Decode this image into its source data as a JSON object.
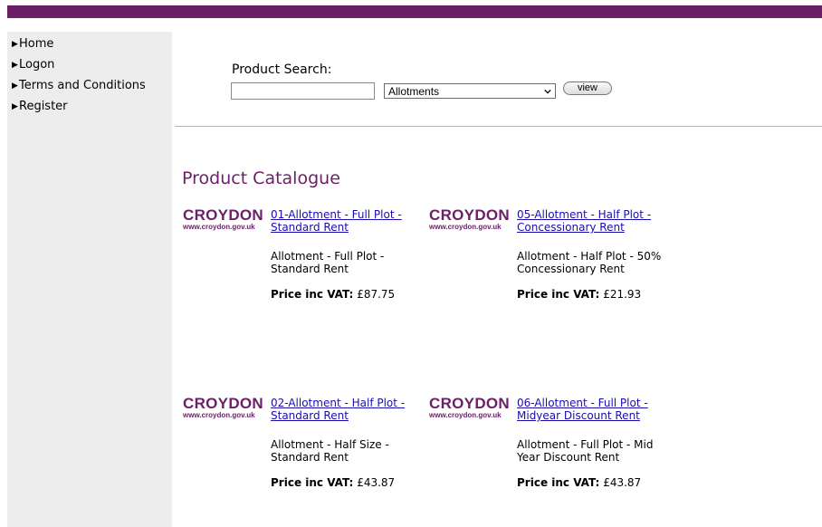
{
  "nav": {
    "items": [
      {
        "label": "Home"
      },
      {
        "label": "Logon"
      },
      {
        "label": "Terms and Conditions"
      },
      {
        "label": "Register"
      }
    ]
  },
  "search": {
    "label": "Product Search:",
    "input_value": "",
    "category_selected": "Allotments",
    "view_button": "view"
  },
  "catalogue": {
    "title": "Product Catalogue",
    "logo_text": "CROYDON",
    "logo_url_text": "www.croydon.gov.uk",
    "price_label": "Price inc VAT:",
    "products": [
      {
        "title": "01-Allotment - Full Plot - Standard Rent",
        "description": "Allotment - Full Plot - Standard Rent",
        "price": "£87.75"
      },
      {
        "title": "05-Allotment - Half Plot - Concessionary Rent",
        "description": "Allotment - Half Plot - 50% Concessionary Rent",
        "price": "£21.93"
      },
      {
        "title": "02-Allotment - Half Plot - Standard Rent",
        "description": "Allotment - Half Size - Standard Rent",
        "price": "£43.87"
      },
      {
        "title": "06-Allotment - Full Plot - Midyear Discount Rent",
        "description": "Allotment - Full Plot - Mid Year Discount Rent",
        "price": "£43.87"
      }
    ]
  },
  "colors": {
    "brand_purple": "#6a1f66",
    "link_blue": "#1a0dab",
    "sidebar_bg": "#ededed"
  }
}
